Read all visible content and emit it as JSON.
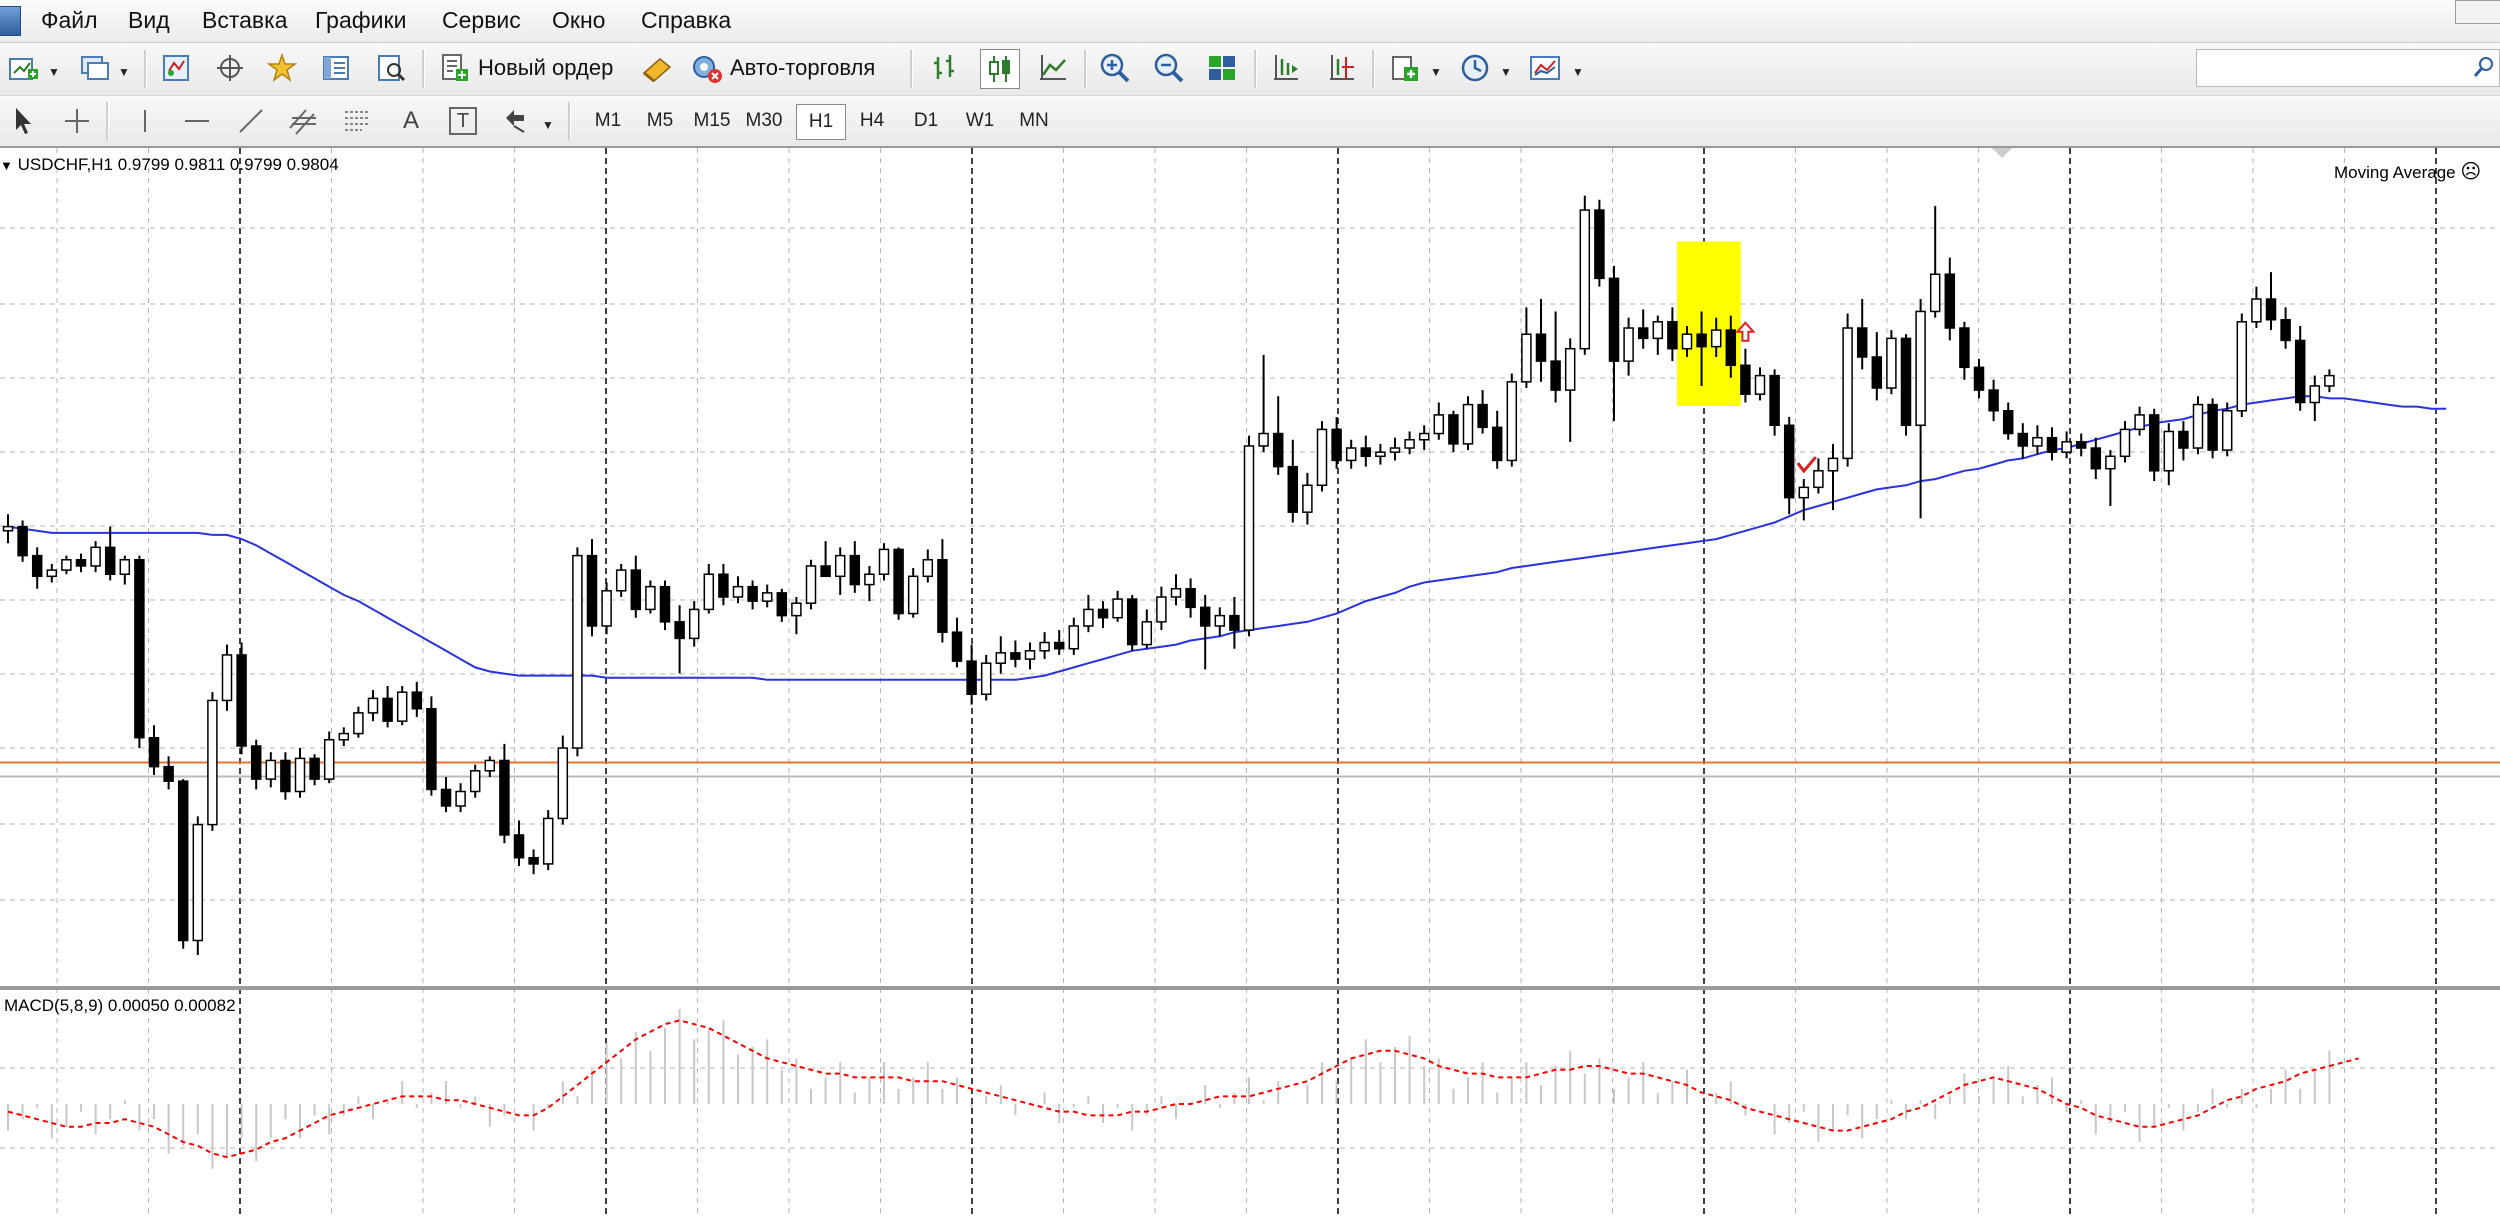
{
  "menu": [
    "Файл",
    "Вид",
    "Вставка",
    "Графики",
    "Сервис",
    "Окно",
    "Справка"
  ],
  "toolbar": {
    "new_order_label": "Новый ордер",
    "auto_trading_label": "Авто-торговля",
    "icons": [
      "new-chart-icon",
      "profiles-icon",
      "market-watch-icon",
      "data-window-icon",
      "navigator-icon",
      "terminal-icon",
      "strategy-tester-icon",
      "bar-chart-icon",
      "candlestick-icon",
      "line-chart-icon",
      "zoom-in-icon",
      "zoom-out-icon",
      "tile-windows-icon",
      "chart-shift-icon",
      "autoscroll-icon",
      "indicators-icon",
      "periods-icon",
      "templates-icon"
    ]
  },
  "drawing_tools": [
    "cursor-icon",
    "crosshair-icon",
    "vertical-line-icon",
    "horizontal-line-icon",
    "trendline-icon",
    "equidistant-channel-icon",
    "fibonacci-icon",
    "text-icon",
    "text-label-icon",
    "arrows-icon"
  ],
  "drawing_text": {
    "text_tool": "A",
    "text_label_tool": "T"
  },
  "timeframes": [
    "M1",
    "M5",
    "M15",
    "M30",
    "H1",
    "H4",
    "D1",
    "W1",
    "MN"
  ],
  "active_timeframe": "H1",
  "chart": {
    "symbol_label": "USDCHF,H1",
    "ohlc": "0.9799 0.9811 0.9799 0.9804",
    "indicator_label": "Moving Average",
    "macd_label": "MACD(5,8,9) 0.00050 0.00082",
    "colors": {
      "bull": "#ffffff",
      "bear": "#000000",
      "ma": "#2a32e0",
      "macd_signal": "#ff0000",
      "macd_hist": "#c8c8c8",
      "hline": "#e8732e",
      "grid": "#b4b4b4",
      "highlight": "#ffff00"
    }
  },
  "chart_data": {
    "type": "candlestick",
    "symbol": "USDCHF",
    "timeframe": "H1",
    "candles": [
      [
        0.975,
        0.9758,
        0.9744,
        0.9752
      ],
      [
        0.9752,
        0.9755,
        0.9735,
        0.9738
      ],
      [
        0.9738,
        0.9742,
        0.9722,
        0.9728
      ],
      [
        0.9728,
        0.9734,
        0.9725,
        0.9731
      ],
      [
        0.9731,
        0.9738,
        0.9729,
        0.9736
      ],
      [
        0.9736,
        0.9739,
        0.973,
        0.9733
      ],
      [
        0.9733,
        0.9745,
        0.973,
        0.9742
      ],
      [
        0.9742,
        0.9752,
        0.9726,
        0.9729
      ],
      [
        0.9729,
        0.9738,
        0.9724,
        0.9736
      ],
      [
        0.9736,
        0.9738,
        0.9645,
        0.965
      ],
      [
        0.965,
        0.9656,
        0.9632,
        0.9636
      ],
      [
        0.9636,
        0.9641,
        0.9625,
        0.9629
      ],
      [
        0.9629,
        0.963,
        0.9548,
        0.9552
      ],
      [
        0.9552,
        0.9612,
        0.9545,
        0.9608
      ],
      [
        0.9608,
        0.9672,
        0.9605,
        0.9668
      ],
      [
        0.9668,
        0.9695,
        0.9663,
        0.969
      ],
      [
        0.969,
        0.9696,
        0.9642,
        0.9646
      ],
      [
        0.9646,
        0.9649,
        0.9625,
        0.963
      ],
      [
        0.963,
        0.9643,
        0.9626,
        0.9639
      ],
      [
        0.9639,
        0.9643,
        0.962,
        0.9624
      ],
      [
        0.9624,
        0.9645,
        0.9621,
        0.964
      ],
      [
        0.964,
        0.9642,
        0.9627,
        0.963
      ],
      [
        0.963,
        0.9653,
        0.9628,
        0.9649
      ],
      [
        0.9649,
        0.9655,
        0.9646,
        0.9652
      ],
      [
        0.9652,
        0.9665,
        0.965,
        0.9662
      ],
      [
        0.9662,
        0.9673,
        0.9658,
        0.9669
      ],
      [
        0.9669,
        0.9675,
        0.9655,
        0.9658
      ],
      [
        0.9658,
        0.9675,
        0.9656,
        0.9672
      ],
      [
        0.9672,
        0.9677,
        0.966,
        0.9664
      ],
      [
        0.9664,
        0.967,
        0.9622,
        0.9625
      ],
      [
        0.9625,
        0.9631,
        0.9614,
        0.9617
      ],
      [
        0.9617,
        0.9628,
        0.9614,
        0.9624
      ],
      [
        0.9624,
        0.9637,
        0.9621,
        0.9634
      ],
      [
        0.9634,
        0.9641,
        0.9631,
        0.9639
      ],
      [
        0.9639,
        0.9647,
        0.9599,
        0.9603
      ],
      [
        0.9603,
        0.961,
        0.9588,
        0.9592
      ],
      [
        0.9592,
        0.9596,
        0.9584,
        0.9589
      ],
      [
        0.9589,
        0.9615,
        0.9586,
        0.9611
      ],
      [
        0.9611,
        0.9651,
        0.9608,
        0.9645
      ],
      [
        0.9645,
        0.9742,
        0.9641,
        0.9738
      ],
      [
        0.9738,
        0.9746,
        0.9699,
        0.9704
      ],
      [
        0.9704,
        0.9725,
        0.97,
        0.9721
      ],
      [
        0.9721,
        0.9734,
        0.9718,
        0.9731
      ],
      [
        0.9731,
        0.9738,
        0.9708,
        0.9712
      ],
      [
        0.9712,
        0.9726,
        0.971,
        0.9723
      ],
      [
        0.9723,
        0.9726,
        0.9702,
        0.9706
      ],
      [
        0.9706,
        0.9714,
        0.9681,
        0.9698
      ],
      [
        0.9698,
        0.9716,
        0.9694,
        0.9712
      ],
      [
        0.9712,
        0.9734,
        0.971,
        0.9729
      ],
      [
        0.9729,
        0.9734,
        0.9714,
        0.9718
      ],
      [
        0.9718,
        0.9728,
        0.9715,
        0.9723
      ],
      [
        0.9723,
        0.9726,
        0.9712,
        0.9716
      ],
      [
        0.9716,
        0.9724,
        0.9713,
        0.972
      ],
      [
        0.972,
        0.9722,
        0.9706,
        0.9709
      ],
      [
        0.9709,
        0.9718,
        0.97,
        0.9715
      ],
      [
        0.9715,
        0.9736,
        0.9712,
        0.9733
      ],
      [
        0.9733,
        0.9745,
        0.973,
        0.9728
      ],
      [
        0.9728,
        0.9742,
        0.9719,
        0.9738
      ],
      [
        0.9738,
        0.9745,
        0.972,
        0.9724
      ],
      [
        0.9724,
        0.9733,
        0.9716,
        0.9729
      ],
      [
        0.9729,
        0.9744,
        0.9726,
        0.9741
      ],
      [
        0.9741,
        0.9742,
        0.9707,
        0.971
      ],
      [
        0.971,
        0.9732,
        0.9708,
        0.9728
      ],
      [
        0.9728,
        0.9741,
        0.9725,
        0.9736
      ],
      [
        0.9736,
        0.9746,
        0.9696,
        0.9701
      ],
      [
        0.9701,
        0.9708,
        0.9684,
        0.9687
      ],
      [
        0.9687,
        0.9695,
        0.9666,
        0.9671
      ],
      [
        0.9671,
        0.969,
        0.9668,
        0.9686
      ],
      [
        0.9686,
        0.9699,
        0.9681,
        0.9691
      ],
      [
        0.9691,
        0.9697,
        0.9684,
        0.9688
      ],
      [
        0.9688,
        0.9696,
        0.9683,
        0.9692
      ],
      [
        0.9692,
        0.9701,
        0.9688,
        0.9696
      ],
      [
        0.9696,
        0.9702,
        0.969,
        0.9693
      ],
      [
        0.9693,
        0.9708,
        0.969,
        0.9704
      ],
      [
        0.9704,
        0.9719,
        0.9701,
        0.9712
      ],
      [
        0.9712,
        0.9716,
        0.9703,
        0.9708
      ],
      [
        0.9708,
        0.9721,
        0.9706,
        0.9717
      ],
      [
        0.9717,
        0.9719,
        0.9692,
        0.9695
      ],
      [
        0.9695,
        0.9712,
        0.9693,
        0.9706
      ],
      [
        0.9706,
        0.9723,
        0.9702,
        0.9718
      ],
      [
        0.9718,
        0.9729,
        0.9714,
        0.9722
      ],
      [
        0.9722,
        0.9727,
        0.9708,
        0.9713
      ],
      [
        0.9713,
        0.9719,
        0.9683,
        0.9704
      ],
      [
        0.9704,
        0.9713,
        0.9699,
        0.9709
      ],
      [
        0.9709,
        0.9718,
        0.9693,
        0.9702
      ],
      [
        0.9702,
        0.9796,
        0.9699,
        0.9791
      ],
      [
        0.9791,
        0.9835,
        0.9788,
        0.9797
      ],
      [
        0.9797,
        0.9815,
        0.9777,
        0.9781
      ],
      [
        0.9781,
        0.9794,
        0.9754,
        0.9759
      ],
      [
        0.9759,
        0.9778,
        0.9753,
        0.9772
      ],
      [
        0.9772,
        0.9803,
        0.9769,
        0.9799
      ],
      [
        0.9799,
        0.9805,
        0.978,
        0.9784
      ],
      [
        0.9784,
        0.9794,
        0.978,
        0.979
      ],
      [
        0.979,
        0.9796,
        0.9781,
        0.9786
      ],
      [
        0.9786,
        0.9792,
        0.9782,
        0.9788
      ],
      [
        0.9788,
        0.9795,
        0.9784,
        0.979
      ],
      [
        0.979,
        0.9798,
        0.9787,
        0.9794
      ],
      [
        0.9794,
        0.9801,
        0.9789,
        0.9797
      ],
      [
        0.9797,
        0.9812,
        0.9794,
        0.9806
      ],
      [
        0.9806,
        0.9808,
        0.9788,
        0.9792
      ],
      [
        0.9792,
        0.9815,
        0.9789,
        0.9811
      ],
      [
        0.9811,
        0.9818,
        0.9797,
        0.98
      ],
      [
        0.98,
        0.9808,
        0.978,
        0.9784
      ],
      [
        0.9784,
        0.9826,
        0.9781,
        0.9822
      ],
      [
        0.9822,
        0.9858,
        0.9819,
        0.9845
      ],
      [
        0.9845,
        0.9862,
        0.9822,
        0.9832
      ],
      [
        0.9832,
        0.9856,
        0.9812,
        0.9818
      ],
      [
        0.9818,
        0.9843,
        0.9793,
        0.9838
      ],
      [
        0.9838,
        0.9912,
        0.9835,
        0.9905
      ],
      [
        0.9905,
        0.991,
        0.9868,
        0.9872
      ],
      [
        0.9872,
        0.9878,
        0.9803,
        0.9832
      ],
      [
        0.9832,
        0.9853,
        0.9825,
        0.9848
      ],
      [
        0.9848,
        0.9857,
        0.9838,
        0.9843
      ],
      [
        0.9843,
        0.9854,
        0.9835,
        0.9851
      ],
      [
        0.9851,
        0.9858,
        0.9832,
        0.9838
      ],
      [
        0.9838,
        0.9849,
        0.9834,
        0.9845
      ],
      [
        0.9845,
        0.9856,
        0.982,
        0.9839
      ],
      [
        0.9839,
        0.9853,
        0.9834,
        0.9847
      ],
      [
        0.9847,
        0.9854,
        0.9824,
        0.983
      ],
      [
        0.983,
        0.9838,
        0.9812,
        0.9816
      ],
      [
        0.9816,
        0.9829,
        0.9813,
        0.9825
      ],
      [
        0.9825,
        0.9828,
        0.9796,
        0.9801
      ],
      [
        0.9801,
        0.9805,
        0.9758,
        0.9766
      ],
      [
        0.9766,
        0.9775,
        0.9755,
        0.9771
      ],
      [
        0.9771,
        0.9785,
        0.9768,
        0.9779
      ],
      [
        0.9779,
        0.9792,
        0.976,
        0.9785
      ],
      [
        0.9785,
        0.9855,
        0.9781,
        0.9848
      ],
      [
        0.9848,
        0.9862,
        0.9828,
        0.9834
      ],
      [
        0.9834,
        0.9846,
        0.9813,
        0.9819
      ],
      [
        0.9819,
        0.9847,
        0.9816,
        0.9843
      ],
      [
        0.9843,
        0.9845,
        0.9796,
        0.9801
      ],
      [
        0.9801,
        0.9862,
        0.9756,
        0.9856
      ],
      [
        0.9856,
        0.9907,
        0.9853,
        0.9874
      ],
      [
        0.9874,
        0.9882,
        0.9842,
        0.9848
      ],
      [
        0.9848,
        0.9851,
        0.9823,
        0.9829
      ],
      [
        0.9829,
        0.9833,
        0.9814,
        0.9818
      ],
      [
        0.9818,
        0.9823,
        0.9803,
        0.9808
      ],
      [
        0.9808,
        0.9812,
        0.9794,
        0.9797
      ],
      [
        0.9797,
        0.9802,
        0.9785,
        0.9791
      ],
      [
        0.9791,
        0.9801,
        0.9787,
        0.9795
      ],
      [
        0.9795,
        0.98,
        0.9784,
        0.9788
      ],
      [
        0.9788,
        0.9798,
        0.9785,
        0.9793
      ],
      [
        0.9793,
        0.9797,
        0.9786,
        0.979
      ],
      [
        0.979,
        0.9795,
        0.9775,
        0.978
      ],
      [
        0.978,
        0.9789,
        0.9762,
        0.9786
      ],
      [
        0.9786,
        0.9803,
        0.9783,
        0.9799
      ],
      [
        0.9799,
        0.981,
        0.9796,
        0.9806
      ],
      [
        0.9806,
        0.9809,
        0.9774,
        0.9779
      ],
      [
        0.9779,
        0.9802,
        0.9772,
        0.9798
      ],
      [
        0.9798,
        0.9803,
        0.9784,
        0.979
      ],
      [
        0.979,
        0.9815,
        0.9787,
        0.9811
      ],
      [
        0.9811,
        0.9814,
        0.9785,
        0.9789
      ],
      [
        0.9789,
        0.9812,
        0.9786,
        0.9808
      ],
      [
        0.9808,
        0.9855,
        0.9805,
        0.9851
      ],
      [
        0.9851,
        0.9868,
        0.9848,
        0.9862
      ],
      [
        0.9862,
        0.9875,
        0.9847,
        0.9852
      ],
      [
        0.9852,
        0.9858,
        0.9838,
        0.9842
      ],
      [
        0.9842,
        0.9849,
        0.9808,
        0.9812
      ],
      [
        0.9812,
        0.9825,
        0.9803,
        0.982
      ],
      [
        0.982,
        0.9828,
        0.9817,
        0.9825
      ]
    ],
    "moving_average": [
      0.9752,
      0.9751,
      0.975,
      0.9749,
      0.9749,
      0.9749,
      0.9749,
      0.9749,
      0.9749,
      0.9749,
      0.9749,
      0.9749,
      0.9749,
      0.9749,
      0.9748,
      0.9748,
      0.9746,
      0.9743,
      0.9739,
      0.9735,
      0.9731,
      0.9727,
      0.9723,
      0.9719,
      0.9716,
      0.9712,
      0.9708,
      0.9704,
      0.97,
      0.9696,
      0.9692,
      0.9688,
      0.9684,
      0.9682,
      0.9681,
      0.968,
      0.968,
      0.968,
      0.968,
      0.968,
      0.968,
      0.9679,
      0.9679,
      0.9679,
      0.9679,
      0.9679,
      0.9679,
      0.9679,
      0.9679,
      0.9679,
      0.9679,
      0.9679,
      0.9678,
      0.9678,
      0.9678,
      0.9678,
      0.9678,
      0.9678,
      0.9678,
      0.9678,
      0.9678,
      0.9678,
      0.9678,
      0.9678,
      0.9678,
      0.9678,
      0.9678,
      0.9678,
      0.9678,
      0.9678,
      0.9679,
      0.968,
      0.9682,
      0.9684,
      0.9686,
      0.9688,
      0.969,
      0.9692,
      0.9693,
      0.9694,
      0.9695,
      0.9697,
      0.9698,
      0.9699,
      0.9701,
      0.9702,
      0.9703,
      0.9704,
      0.9705,
      0.9706,
      0.9708,
      0.971,
      0.9713,
      0.9716,
      0.9718,
      0.972,
      0.9723,
      0.9725,
      0.9726,
      0.9727,
      0.9728,
      0.9729,
      0.973,
      0.9732,
      0.9733,
      0.9734,
      0.9735,
      0.9736,
      0.9737,
      0.9738,
      0.9739,
      0.974,
      0.9741,
      0.9742,
      0.9743,
      0.9744,
      0.9745,
      0.9746,
      0.9748,
      0.975,
      0.9752,
      0.9754,
      0.9757,
      0.976,
      0.9762,
      0.9764,
      0.9766,
      0.9768,
      0.977,
      0.9771,
      0.9772,
      0.9774,
      0.9775,
      0.9777,
      0.9779,
      0.978,
      0.9782,
      0.9784,
      0.9785,
      0.9787,
      0.9789,
      0.979,
      0.9792,
      0.9794,
      0.9796,
      0.9798,
      0.98,
      0.9802,
      0.9803,
      0.9804,
      0.9806,
      0.9808,
      0.9809,
      0.9811,
      0.9812,
      0.9813,
      0.9814,
      0.9815,
      0.9815,
      0.9814,
      0.9814,
      0.9813,
      0.9812,
      0.9811,
      0.981,
      0.981,
      0.9809,
      0.9809
    ],
    "macd_signal_series": [
      -0.0002,
      -0.0003,
      -0.0004,
      -0.0005,
      -0.0006,
      -0.0006,
      -0.0005,
      -0.0005,
      -0.0004,
      -0.0005,
      -0.0006,
      -0.0008,
      -0.001,
      -0.0011,
      -0.0013,
      -0.0014,
      -0.0013,
      -0.0012,
      -0.001,
      -0.0009,
      -0.0007,
      -0.0005,
      -0.0003,
      -0.0002,
      -0.0001,
      0.0,
      0.0001,
      0.0002,
      0.0002,
      0.0002,
      0.0001,
      0.0001,
      0.0,
      -0.0001,
      -0.0002,
      -0.0003,
      -0.0003,
      -0.0001,
      0.0002,
      0.0005,
      0.0008,
      0.0011,
      0.0014,
      0.0017,
      0.0019,
      0.0021,
      0.0022,
      0.0021,
      0.002,
      0.0018,
      0.0016,
      0.0014,
      0.0012,
      0.0011,
      0.001,
      0.0009,
      0.0008,
      0.0008,
      0.0007,
      0.0007,
      0.0007,
      0.0007,
      0.0006,
      0.0006,
      0.0006,
      0.0005,
      0.0004,
      0.0003,
      0.0002,
      0.0001,
      0.0,
      -0.0001,
      -0.0002,
      -0.0002,
      -0.0003,
      -0.0003,
      -0.0003,
      -0.0002,
      -0.0002,
      -0.0001,
      0.0,
      0.0,
      0.0001,
      0.0002,
      0.0002,
      0.0002,
      0.0003,
      0.0004,
      0.0005,
      0.0006,
      0.0008,
      0.001,
      0.0012,
      0.0013,
      0.0014,
      0.0014,
      0.0013,
      0.0012,
      0.001,
      0.0009,
      0.0008,
      0.0008,
      0.0007,
      0.0007,
      0.0007,
      0.0008,
      0.0009,
      0.0009,
      0.001,
      0.001,
      0.0009,
      0.0008,
      0.0008,
      0.0007,
      0.0006,
      0.0005,
      0.0003,
      0.0002,
      0.0001,
      -0.0001,
      -0.0002,
      -0.0003,
      -0.0004,
      -0.0005,
      -0.0006,
      -0.0007,
      -0.0007,
      -0.0006,
      -0.0005,
      -0.0004,
      -0.0002,
      -0.0001,
      0.0001,
      0.0003,
      0.0005,
      0.0006,
      0.0007,
      0.0006,
      0.0005,
      0.0004,
      0.0002,
      0.0,
      -0.0001,
      -0.0003,
      -0.0004,
      -0.0005,
      -0.0006,
      -0.0006,
      -0.0005,
      -0.0004,
      -0.0003,
      -0.0001,
      0.0001,
      0.0002,
      0.0004,
      0.0005,
      0.0006,
      0.0008,
      0.0009,
      0.001,
      0.0011,
      0.0012
    ],
    "horizontal_line": 0.9638,
    "price_min": 0.953,
    "price_max": 0.9935,
    "macd_min": -0.003,
    "macd_max": 0.003,
    "highlight_candles": [
      115,
      118
    ],
    "buy_arrow_candle": 119,
    "check_mark_candle": 123
  }
}
